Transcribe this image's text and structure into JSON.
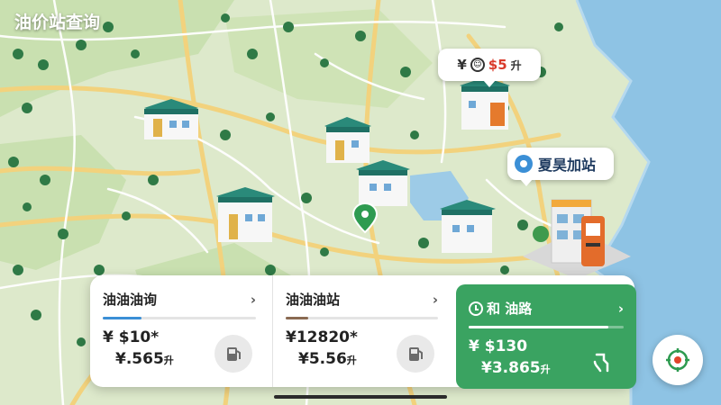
{
  "app": {
    "title": "油价站查询"
  },
  "map": {
    "colors": {
      "land": "#dce9c9",
      "park": "#c7dfae",
      "water": "#8fc4e6",
      "road": "#f4d98a",
      "minor_road": "#ffffff"
    },
    "price_bubble": {
      "prefix": "¥",
      "marker_glyph": "☺",
      "price": "$5",
      "unit": "升"
    },
    "station_tag": {
      "icon": "pin-icon",
      "label": "夏昊加站"
    },
    "current_location_icon": "green-location-pin-icon"
  },
  "cards": [
    {
      "name": "油油油询",
      "chevron": "›",
      "price": "¥ $10*",
      "sub_price": "¥.565",
      "sub_unit": "升",
      "icon": "fuel-pump-icon",
      "bar_color": "#3b8fd6",
      "bar_fill": 0.25
    },
    {
      "name": "油油油站",
      "chevron": "›",
      "price": "¥12820*",
      "sub_price": "¥5.56",
      "sub_unit": "升",
      "icon": "fuel-pump-icon",
      "bar_color": "#8a6a52",
      "bar_fill": 0.15
    },
    {
      "name": "和 油路",
      "chevron": "›",
      "price": "¥ $130",
      "sub_price": "¥3.865",
      "sub_unit": "升",
      "icon": "fuel-nozzle-icon",
      "bar_color": "#ffffff",
      "bar_fill": 0.9,
      "active": true
    }
  ],
  "controls": {
    "locate_icon": "compass-locate-icon"
  }
}
